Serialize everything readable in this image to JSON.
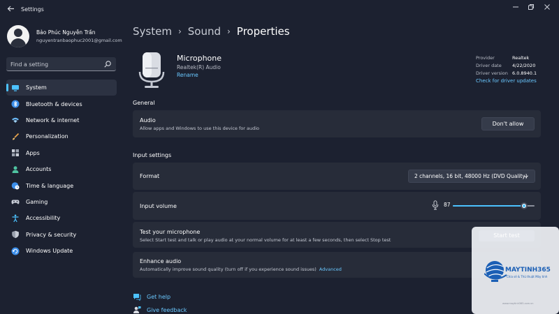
{
  "window": {
    "title": "Settings"
  },
  "profile": {
    "name": "Bảo Phúc Nguyễn Trần",
    "email": "nguyentranbaophuc2001@gmail.com"
  },
  "search": {
    "placeholder": "Find a setting"
  },
  "nav": {
    "active": "System",
    "items": [
      {
        "label": "System",
        "icon": "monitor-icon"
      },
      {
        "label": "Bluetooth & devices",
        "icon": "bluetooth-icon"
      },
      {
        "label": "Network & internet",
        "icon": "wifi-icon"
      },
      {
        "label": "Personalization",
        "icon": "brush-icon"
      },
      {
        "label": "Apps",
        "icon": "apps-icon"
      },
      {
        "label": "Accounts",
        "icon": "person-icon"
      },
      {
        "label": "Time & language",
        "icon": "globe-clock-icon"
      },
      {
        "label": "Gaming",
        "icon": "gamepad-icon"
      },
      {
        "label": "Accessibility",
        "icon": "accessibility-icon"
      },
      {
        "label": "Privacy & security",
        "icon": "shield-icon"
      },
      {
        "label": "Windows Update",
        "icon": "update-icon"
      }
    ]
  },
  "breadcrumb": {
    "parts": [
      "System",
      "Sound"
    ],
    "current": "Properties",
    "separator": "›"
  },
  "device": {
    "name": "Microphone",
    "subtitle": "Realtek(R) Audio",
    "rename_label": "Rename",
    "driver": {
      "provider_label": "Provider",
      "provider": "Realtek",
      "date_label": "Driver date",
      "date": "4/22/2020",
      "version_label": "Driver version",
      "version": "6.0.8940.1",
      "update_link": "Check for driver updates"
    }
  },
  "general": {
    "title": "General",
    "audio": {
      "title": "Audio",
      "desc": "Allow apps and Windows to use this device for audio",
      "button": "Don't allow"
    }
  },
  "input_settings": {
    "title": "Input settings",
    "format": {
      "label": "Format",
      "value": "2 channels, 16 bit, 48000 Hz (DVD Quality)"
    },
    "volume": {
      "label": "Input volume",
      "value": 87,
      "value_text": "87"
    },
    "test": {
      "title": "Test your microphone",
      "desc": "Select Start test and talk or play audio at your normal volume for at least a few seconds, then select Stop test",
      "button": "Start test"
    },
    "enhance": {
      "title": "Enhance audio",
      "desc": "Automatically improve sound quality (turn off if you experience sound issues)",
      "link": "Advanced"
    }
  },
  "footer": {
    "help": "Get help",
    "feedback": "Give feedback"
  },
  "watermark": {
    "brand": "MAYTINH365",
    "tagline": "Chia sẻ & Thủ thuật Máy tính",
    "url": "www.maytinh365.com.vn"
  },
  "colors": {
    "background": "#1c2130",
    "card": "#272c39",
    "accent": "#4cc2ff",
    "link": "#6ac8ff"
  }
}
